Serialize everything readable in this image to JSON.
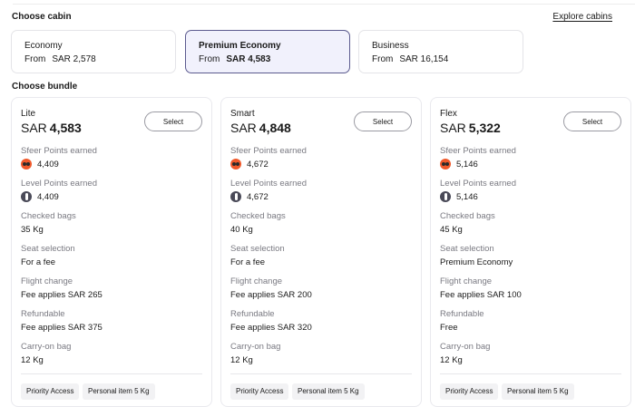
{
  "cabin_section": {
    "title": "Choose cabin",
    "explore_label": "Explore cabins",
    "cabins": [
      {
        "name": "Economy",
        "from_label": "From",
        "price": "SAR 2,578"
      },
      {
        "name": "Premium Economy",
        "from_label": "From",
        "price": "SAR 4,583"
      },
      {
        "name": "Business",
        "from_label": "From",
        "price": "SAR 16,154"
      }
    ],
    "selected_index": 1
  },
  "bundle_section": {
    "title": "Choose bundle",
    "labels": {
      "sfeer": "Sfeer Points earned",
      "level": "Level Points earned",
      "bags": "Checked bags",
      "seat": "Seat selection",
      "change": "Flight change",
      "refund": "Refundable",
      "carry": "Carry-on bag"
    },
    "bundles": [
      {
        "name": "Lite",
        "currency": "SAR",
        "price": "4,583",
        "select_label": "Select",
        "sfeer_points": "4,409",
        "level_points": "4,409",
        "checked_bags": "35 Kg",
        "seat_selection": "For a fee",
        "flight_change": "Fee applies SAR 265",
        "refundable": "Fee applies SAR 375",
        "carry_on": "12 Kg",
        "tags": [
          "Priority Access",
          "Personal item 5 Kg"
        ]
      },
      {
        "name": "Smart",
        "currency": "SAR",
        "price": "4,848",
        "select_label": "Select",
        "sfeer_points": "4,672",
        "level_points": "4,672",
        "checked_bags": "40 Kg",
        "seat_selection": "For a fee",
        "flight_change": "Fee applies SAR 200",
        "refundable": "Fee applies SAR 320",
        "carry_on": "12 Kg",
        "tags": [
          "Priority Access",
          "Personal item 5 Kg"
        ]
      },
      {
        "name": "Flex",
        "currency": "SAR",
        "price": "5,322",
        "select_label": "Select",
        "sfeer_points": "5,146",
        "level_points": "5,146",
        "checked_bags": "45 Kg",
        "seat_selection": "Premium Economy",
        "flight_change": "Fee applies SAR 100",
        "refundable": "Free",
        "carry_on": "12 Kg",
        "tags": [
          "Priority Access",
          "Personal item 5 Kg"
        ]
      }
    ]
  },
  "icons": {
    "sfeer": "sfeer-points-icon",
    "level": "level-points-icon"
  },
  "colors": {
    "selected_border": "#5b5a8e",
    "selected_bg": "#f1f1fc",
    "sfeer_icon": "#f0592b",
    "level_icon": "#4a4a58"
  }
}
